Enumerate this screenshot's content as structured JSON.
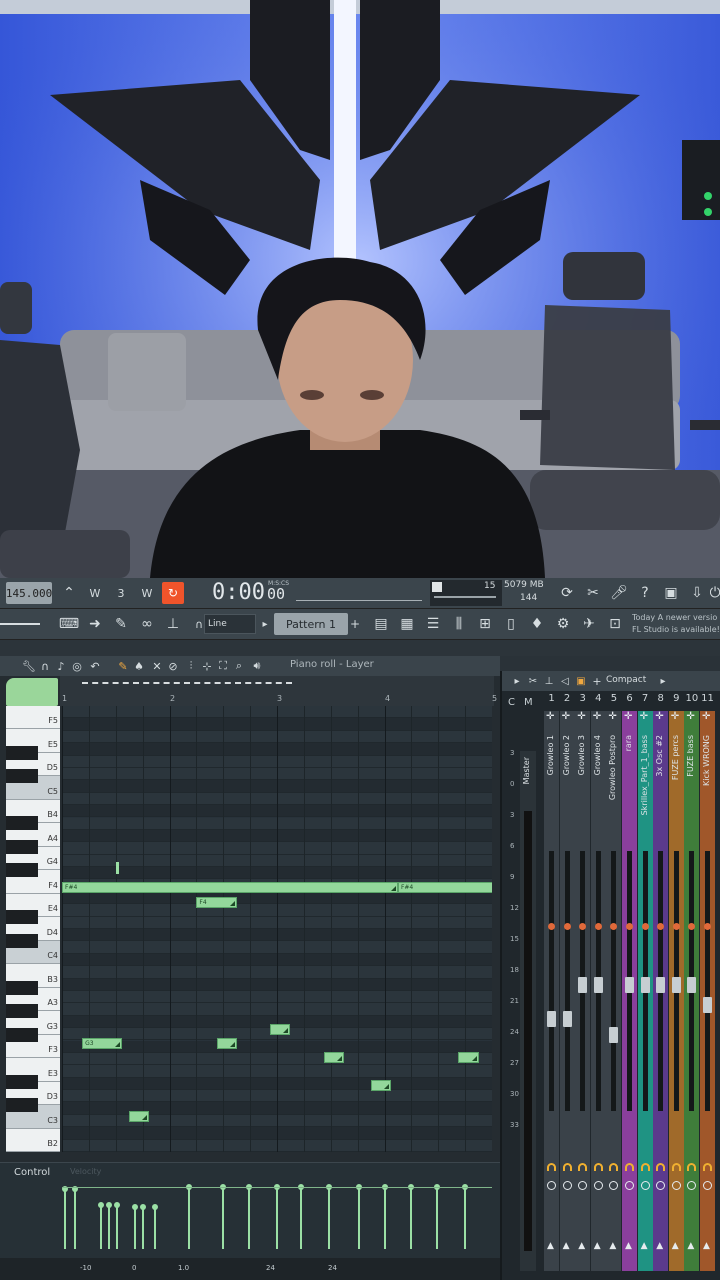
{
  "transport": {
    "tempo": "145.000",
    "time_main": "0:00",
    "time_sub": "00",
    "time_unit": "M:S:CS",
    "cpu_value": "15",
    "memory": "5079 MB",
    "polyphony": "144",
    "snap_mode": "Line",
    "pattern_name": "Pattern 1",
    "news_line1": "Today  A newer versio",
    "news_line2": "FL Studio is available!"
  },
  "piano_roll": {
    "title": "Piano roll - Layer",
    "bar_numbers": [
      "1",
      "2",
      "3",
      "4",
      "5"
    ],
    "key_labels": [
      "F5",
      "E5",
      "D5",
      "C5",
      "B4",
      "A4",
      "G4",
      "F4",
      "E4",
      "D4",
      "C4",
      "B3",
      "A3",
      "G3",
      "F3",
      "E3",
      "D3",
      "C3",
      "B2"
    ],
    "note_labels": {
      "f4_a": "F#4",
      "f4_b": "F#4",
      "f4_short": "F4",
      "g3": "G3"
    },
    "control_label": "Control",
    "control_sub": "Velocity",
    "bottom_values": [
      "-10",
      "0",
      "1.0",
      "24",
      "24"
    ]
  },
  "mixer": {
    "view_mode": "Compact",
    "header_c": "C",
    "header_m": "M",
    "scale": [
      "3",
      "0",
      "3",
      "6",
      "9",
      "12",
      "15",
      "18",
      "21",
      "24",
      "27",
      "30",
      "33"
    ],
    "master_label": "Master",
    "channels": [
      {
        "num": "1",
        "name": "Growleo 1",
        "color": "#3a4249"
      },
      {
        "num": "2",
        "name": "Growleo 2",
        "color": "#3a4249"
      },
      {
        "num": "3",
        "name": "Growleo 3",
        "color": "#3a4249"
      },
      {
        "num": "4",
        "name": "Growleo 4",
        "color": "#3a4249"
      },
      {
        "num": "5",
        "name": "Growleo Postpro",
        "color": "#3a4249"
      },
      {
        "num": "6",
        "name": "rara",
        "color": "#8a3f9c"
      },
      {
        "num": "7",
        "name": "Skrillex_Part_1_bass",
        "color": "#1f9383"
      },
      {
        "num": "8",
        "name": "3x Osc #2",
        "color": "#5b3a8c"
      },
      {
        "num": "9",
        "name": "FUZE percs",
        "color": "#a06a2a"
      },
      {
        "num": "10",
        "name": "FUZE bass",
        "color": "#3f7d3a"
      },
      {
        "num": "11",
        "name": "Kick WRONG",
        "color": "#a0572a"
      }
    ]
  },
  "colors": {
    "accent_orange": "#f0542b",
    "note_green": "#93d79b",
    "wall_blue": "#3f5fe0"
  }
}
